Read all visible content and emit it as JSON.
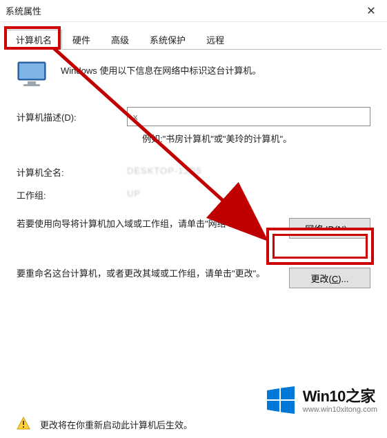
{
  "window": {
    "title": "系统属性",
    "close_icon": "✕"
  },
  "tabs": [
    {
      "label": "计算机名",
      "active": true
    },
    {
      "label": "硬件",
      "active": false
    },
    {
      "label": "高级",
      "active": false
    },
    {
      "label": "系统保护",
      "active": false
    },
    {
      "label": "远程",
      "active": false
    }
  ],
  "intro": "Windows 使用以下信息在网络中标识这台计算机。",
  "description": {
    "label": "计算机描述(D):",
    "value": "",
    "placeholder": "x",
    "hint": "例如:\"书房计算机\"或\"美玲的计算机\"。"
  },
  "full_name": {
    "label": "计算机全名:",
    "value": "DESKTOP-1JD5"
  },
  "workgroup": {
    "label": "工作组:",
    "value": "UP"
  },
  "network_id": {
    "text": "若要使用向导将计算机加入域或工作组，请单击\"网络 ID\"。",
    "button_prefix": "网络 ID(",
    "button_hotkey": "N",
    "button_suffix": ")..."
  },
  "rename": {
    "text": "要重命名这台计算机，或者更改其域或工作组，请单击\"更改\"。",
    "button_prefix": "更改(",
    "button_hotkey": "C",
    "button_suffix": ")..."
  },
  "restart_notice": "更改将在你重新启动此计算机后生效。",
  "watermark": {
    "brand": "Win10之家",
    "url": "www.win10xitong.com"
  }
}
